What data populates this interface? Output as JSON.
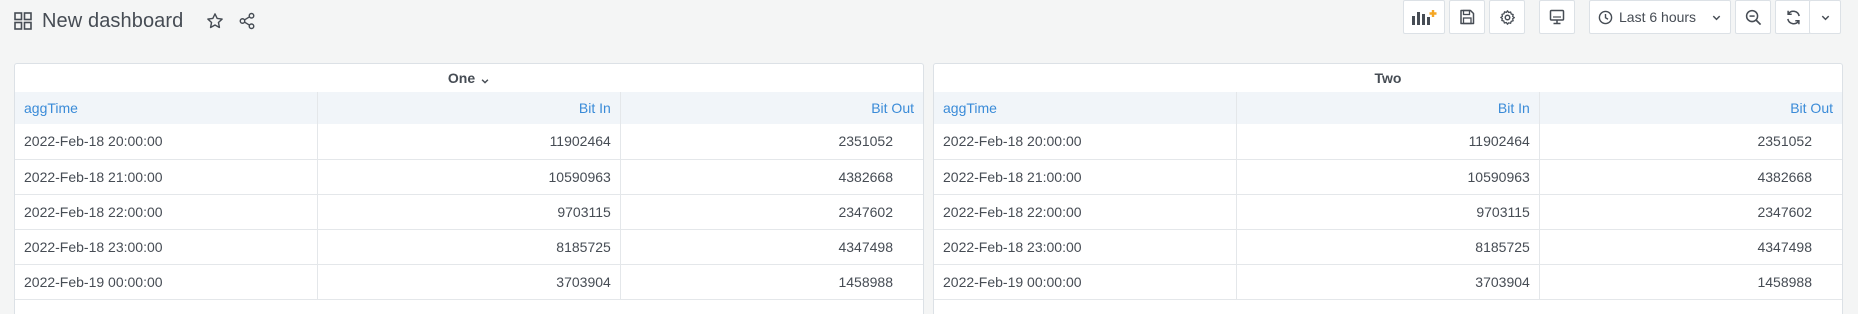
{
  "header": {
    "title": "New dashboard",
    "icons": [
      "dashboard-grid-icon",
      "star-icon",
      "share-icon"
    ]
  },
  "toolbar": {
    "buttons": [
      "add-panel-icon",
      "save-icon",
      "settings-icon",
      "tv-mode-icon"
    ],
    "time_range_label": "Last 6 hours",
    "time_icons": [
      "clock-icon",
      "chevron-down-icon",
      "zoom-out-icon",
      "refresh-icon",
      "chevron-down-icon"
    ],
    "accent_add_panel": "#f5a623"
  },
  "panels": [
    {
      "title": "One",
      "has_menu_chevron": true,
      "columns": [
        "aggTime",
        "Bit In",
        "Bit Out"
      ],
      "rows": [
        [
          "2022-Feb-18 20:00:00",
          "11902464",
          "2351052"
        ],
        [
          "2022-Feb-18 21:00:00",
          "10590963",
          "4382668"
        ],
        [
          "2022-Feb-18 22:00:00",
          "9703115",
          "2347602"
        ],
        [
          "2022-Feb-18 23:00:00",
          "8185725",
          "4347498"
        ],
        [
          "2022-Feb-19 00:00:00",
          "3703904",
          "1458988"
        ]
      ]
    },
    {
      "title": "Two",
      "has_menu_chevron": false,
      "columns": [
        "aggTime",
        "Bit In",
        "Bit Out"
      ],
      "rows": [
        [
          "2022-Feb-18 20:00:00",
          "11902464",
          "2351052"
        ],
        [
          "2022-Feb-18 21:00:00",
          "10590963",
          "4382668"
        ],
        [
          "2022-Feb-18 22:00:00",
          "9703115",
          "2347602"
        ],
        [
          "2022-Feb-18 23:00:00",
          "8185725",
          "4347498"
        ],
        [
          "2022-Feb-19 00:00:00",
          "3703904",
          "1458988"
        ]
      ]
    }
  ],
  "colors": {
    "header_link": "#3a8bd8",
    "text": "#464c54",
    "background": "#f4f5f5",
    "border": "#dce1e6"
  }
}
